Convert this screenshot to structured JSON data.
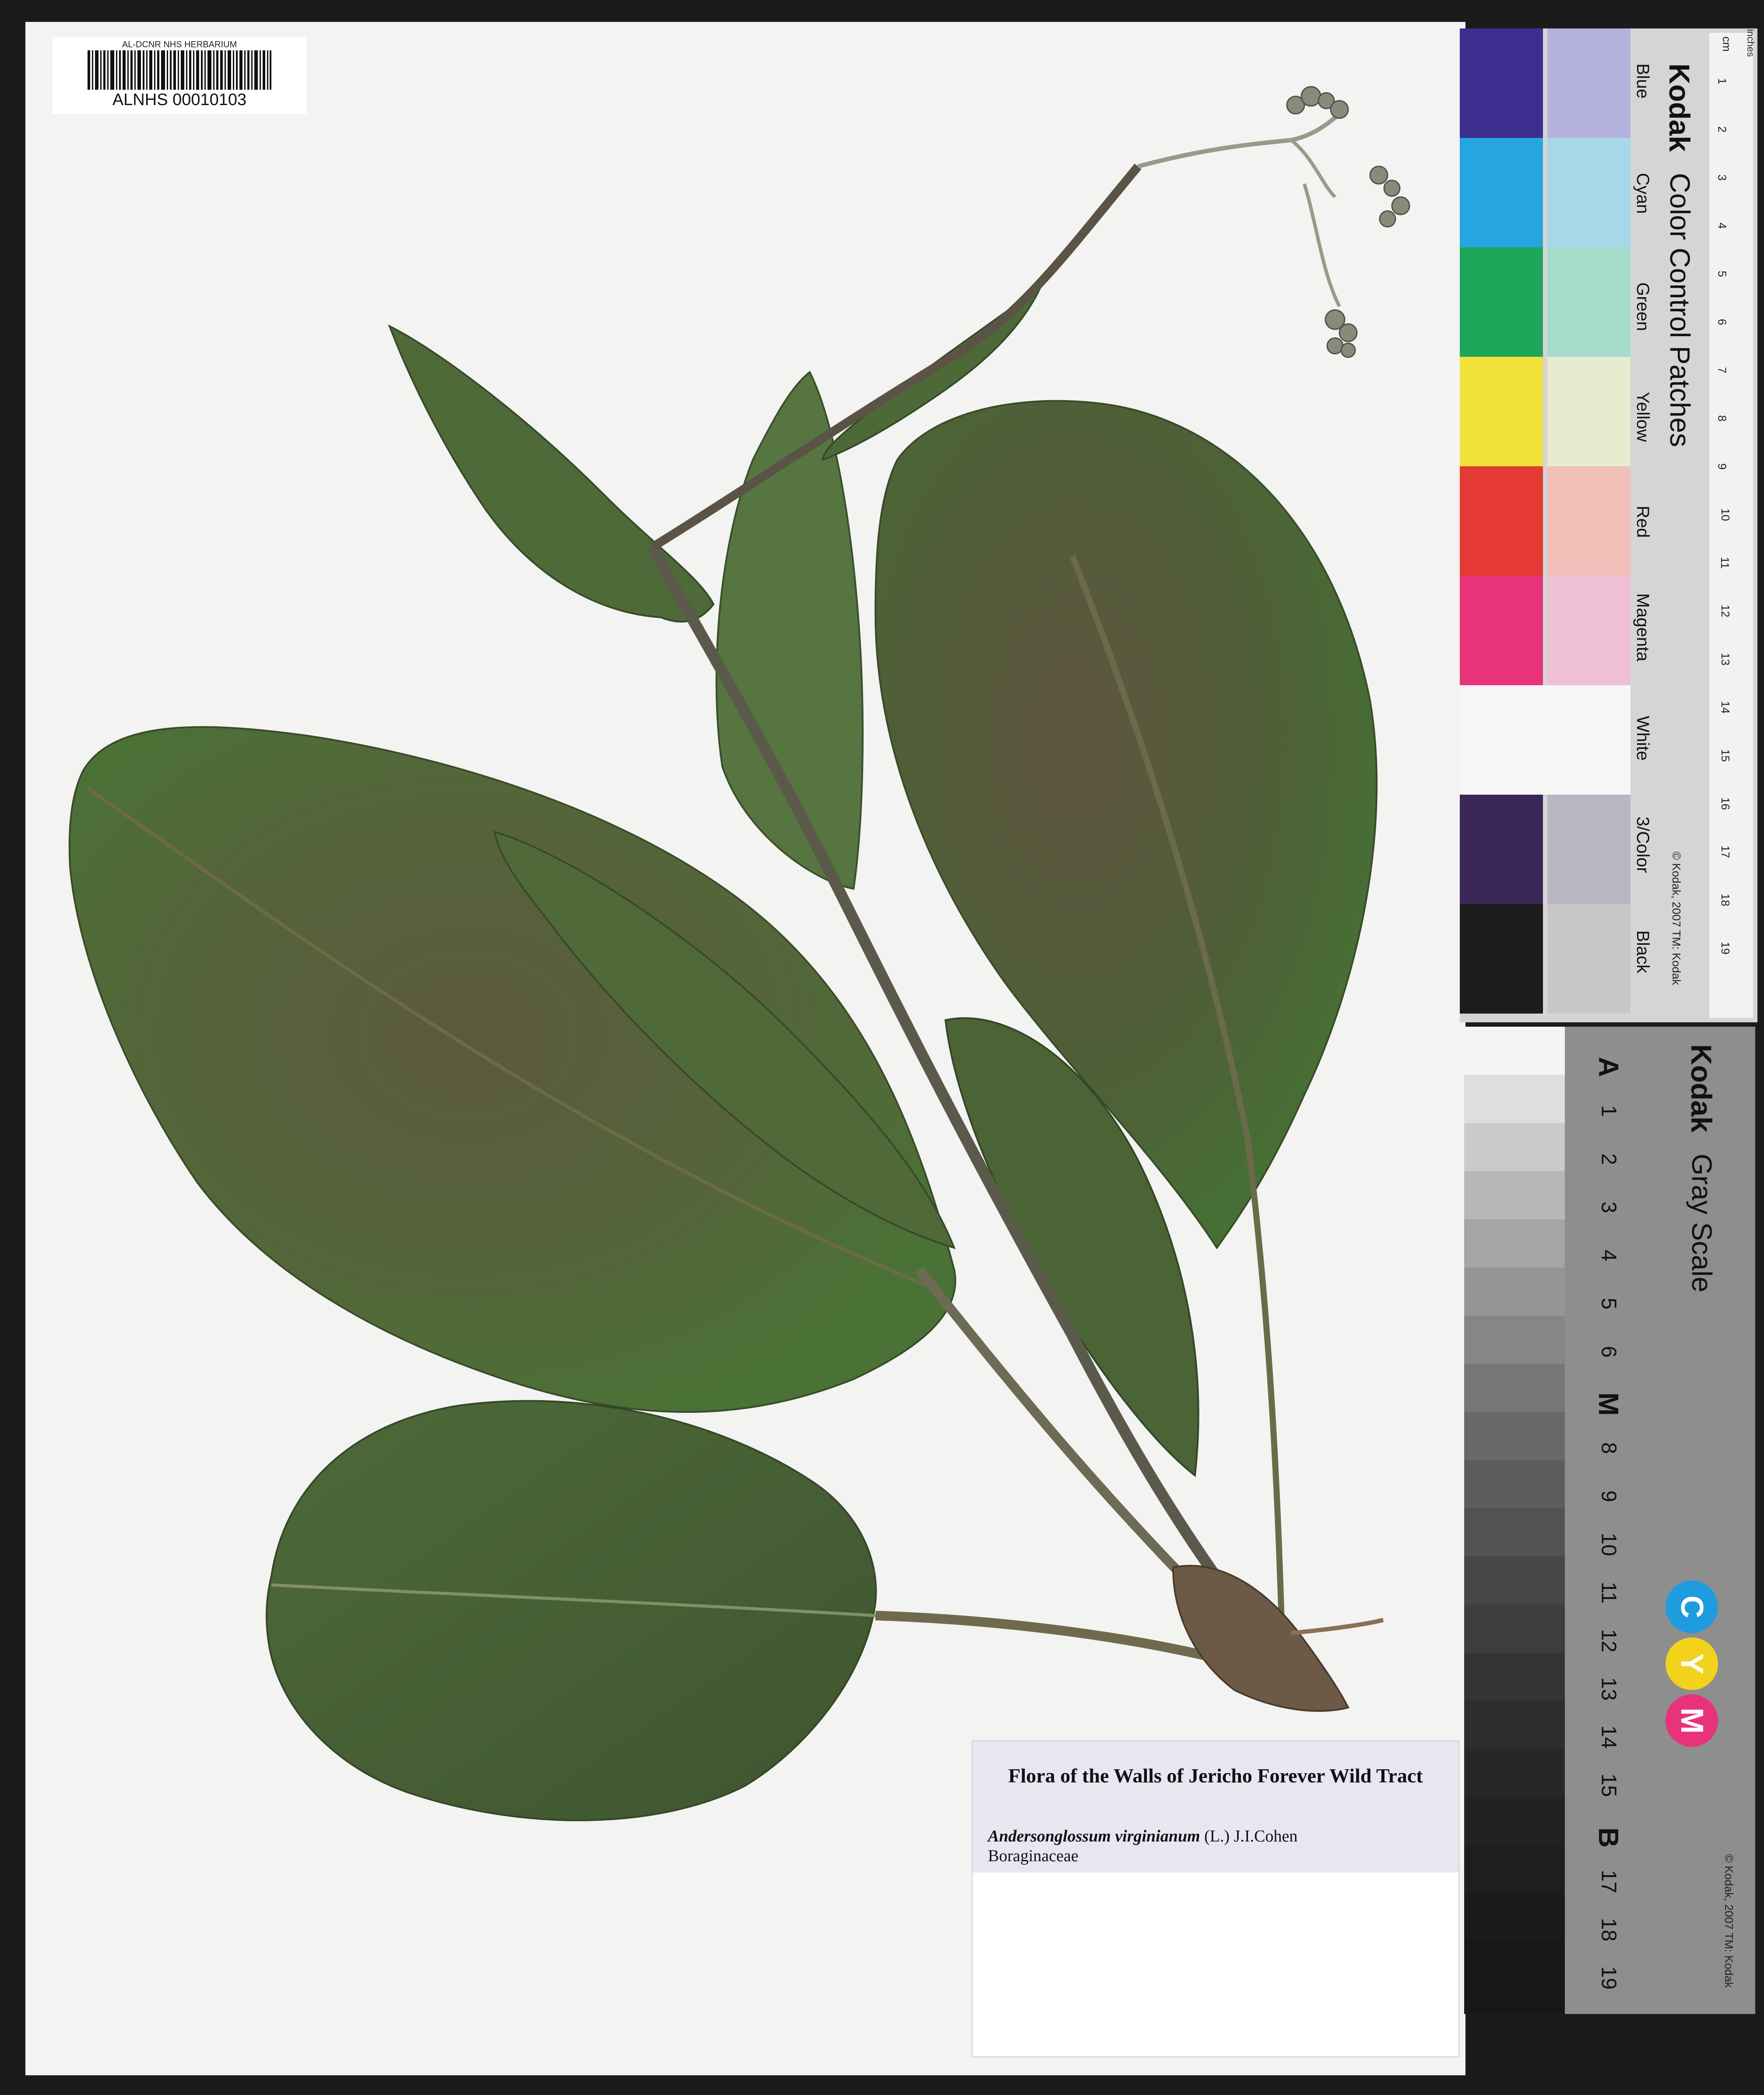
{
  "barcode": {
    "institution": "AL-DCNR NHS HERBARIUM",
    "catalog_number": "ALNHS 00010103"
  },
  "label": {
    "title": "Flora of the Walls of Jericho Forever Wild Tract",
    "scientific_name": "Andersonglossum virginianum",
    "authority": "(L.) J.I.Cohen",
    "family": "Boraginaceae"
  },
  "color_card": {
    "brand": "Kodak",
    "title": "Color Control Patches",
    "copyright": "© Kodak, 2007 TM: Kodak",
    "patches": [
      {
        "label": "Blue",
        "color": "#3d2f8f",
        "tint": "#b4b1dc"
      },
      {
        "label": "Cyan",
        "color": "#25a6e0",
        "tint": "#a8d7ea"
      },
      {
        "label": "Green",
        "color": "#1ea65a",
        "tint": "#a6dccb"
      },
      {
        "label": "Yellow",
        "color": "#f2e23a",
        "tint": "#e7ecd0"
      },
      {
        "label": "Red",
        "color": "#e53934",
        "tint": "#f0c0b9"
      },
      {
        "label": "Magenta",
        "color": "#e8327a",
        "tint": "#efbfd4"
      },
      {
        "label": "White",
        "color": "#f6f6f6",
        "tint": "#f6f6f6"
      },
      {
        "label": "3/Color",
        "color": "#3a2657",
        "tint": "#b8b6c3"
      },
      {
        "label": "Black",
        "color": "#1c1c1c",
        "tint": "#c7c7c7"
      }
    ],
    "ruler_units": "cm",
    "ruler_units_alt": "inches",
    "ruler_numbers": [
      "1",
      "2",
      "3",
      "4",
      "5",
      "6",
      "7",
      "8",
      "9",
      "10",
      "11",
      "12",
      "13",
      "14",
      "15",
      "16",
      "17",
      "18",
      "19"
    ]
  },
  "gray_card": {
    "brand": "Kodak",
    "title": "Gray Scale",
    "copyright": "© Kodak, 2007 TM: Kodak",
    "steps": [
      "A",
      "1",
      "2",
      "3",
      "4",
      "5",
      "6",
      "M",
      "8",
      "9",
      "10",
      "11",
      "12",
      "13",
      "14",
      "15",
      "B",
      "17",
      "18",
      "19"
    ],
    "cmy": [
      {
        "letter": "C",
        "color": "#1f9be0"
      },
      {
        "letter": "Y",
        "color": "#f2d21b"
      },
      {
        "letter": "M",
        "color": "#e8327a"
      }
    ]
  }
}
